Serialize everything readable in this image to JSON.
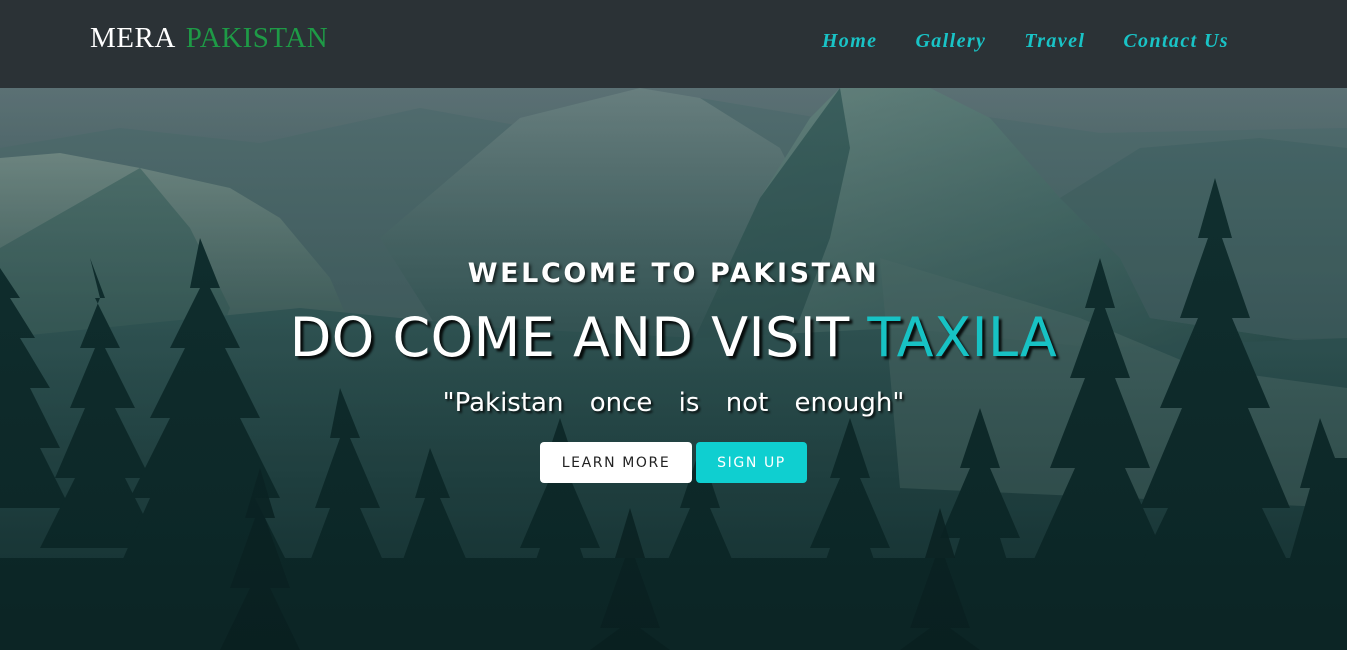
{
  "brand": {
    "word1": "MERA",
    "word2": "PAKISTAN"
  },
  "nav": {
    "items": [
      {
        "label": "Home"
      },
      {
        "label": "Gallery"
      },
      {
        "label": "Travel"
      },
      {
        "label": "Contact Us"
      }
    ]
  },
  "hero": {
    "welcome": "WELCOME TO PAKISTAN",
    "headline_main": "DO COME AND VISIT ",
    "headline_accent": "TAXILA",
    "tagline": "\"Pakistan once is not enough\"",
    "learn_more": "LEARN MORE",
    "sign_up": "SIGN UP"
  },
  "colors": {
    "navbar_bg": "#2b3236",
    "nav_link": "#19c3c6",
    "brand_accent": "#1e9a46",
    "headline_accent": "#17c2c4",
    "signup_bg": "#0fcfd0"
  }
}
